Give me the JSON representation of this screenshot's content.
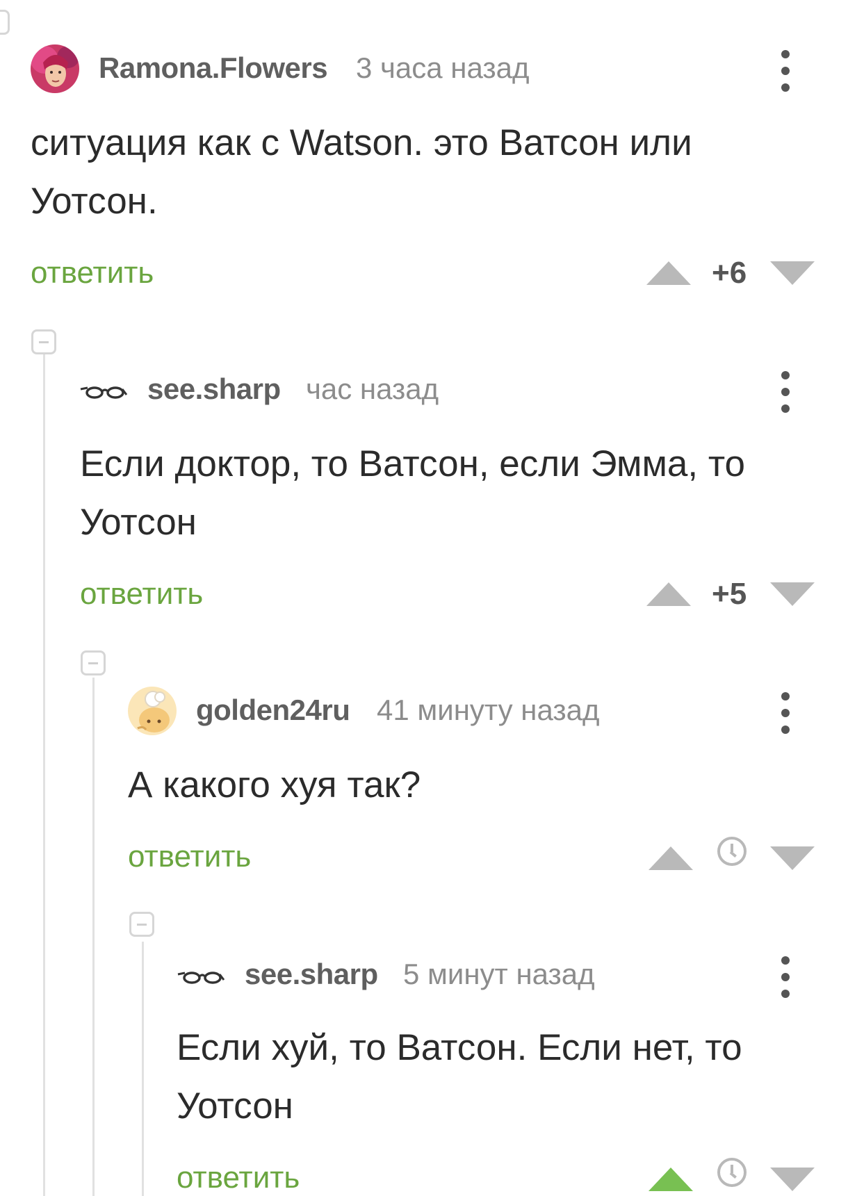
{
  "comments": [
    {
      "author": "Ramona.Flowers",
      "time": "3 часа назад",
      "avatar": "photo-avatar",
      "text_lines": [
        "ситуация как с Watson. это Ватсон или",
        "Уотсон."
      ],
      "reply_label": "ответить",
      "score": "+6",
      "upvoted": false
    },
    {
      "author": "see.sharp",
      "time": "час назад",
      "avatar": "glasses-icon",
      "text_lines": [
        "Если доктор, то Ватсон, если Эмма, то",
        "Уотсон"
      ],
      "reply_label": "ответить",
      "score": "+5",
      "upvoted": false
    },
    {
      "author": "golden24ru",
      "time": "41 минуту назад",
      "avatar": "cartoon-avatar",
      "text_lines": [
        "А какого хуя так?"
      ],
      "reply_label": "ответить",
      "score_icon": "clock-icon",
      "upvoted": false
    },
    {
      "author": "see.sharp",
      "time": "5 минут назад",
      "avatar": "glasses-icon",
      "text_lines": [
        "Если хуй, то Ватсон. Если нет, то",
        "Уотсон"
      ],
      "reply_label": "ответить",
      "score_icon": "clock-icon",
      "upvoted": true
    }
  ],
  "colors": {
    "accent_green": "#6aa53f",
    "upvote_active": "#78c052",
    "vote_inactive": "#b9b9b9",
    "author_gray": "#5f5f5f",
    "time_gray": "#8c8c8c",
    "text": "#2b2b2b"
  }
}
